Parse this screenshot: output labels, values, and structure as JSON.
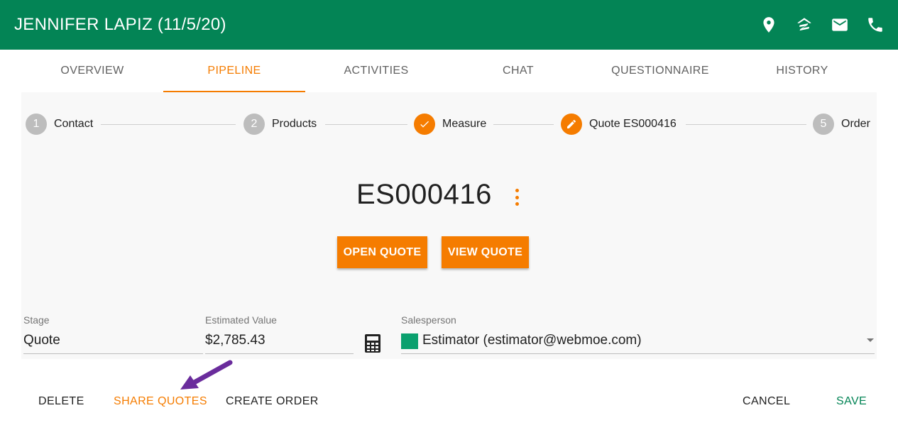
{
  "header": {
    "title": "JENNIFER LAPIZ (11/5/20)",
    "icons": [
      "location-pin-icon",
      "zillow-icon",
      "mail-icon",
      "phone-icon"
    ],
    "color": "#038455"
  },
  "tabs": [
    {
      "label": "OVERVIEW",
      "active": false
    },
    {
      "label": "PIPELINE",
      "active": true
    },
    {
      "label": "ACTIVITIES",
      "active": false
    },
    {
      "label": "CHAT",
      "active": false
    },
    {
      "label": "QUESTIONNAIRE",
      "active": false
    },
    {
      "label": "HISTORY",
      "active": false
    }
  ],
  "stepper": [
    {
      "marker": "1",
      "label": "Contact",
      "state": "pending"
    },
    {
      "marker": "2",
      "label": "Products",
      "state": "pending"
    },
    {
      "marker": "check-icon",
      "label": "Measure",
      "state": "done"
    },
    {
      "marker": "pencil-icon",
      "label": "Quote ES000416",
      "state": "current"
    },
    {
      "marker": "5",
      "label": "Order",
      "state": "pending"
    }
  ],
  "quote": {
    "number": "ES000416",
    "open_label": "OPEN QUOTE",
    "view_label": "VIEW QUOTE"
  },
  "fields": {
    "stage": {
      "label": "Stage",
      "value": "Quote"
    },
    "estimated_value": {
      "label": "Estimated Value",
      "value": "$2,785.43"
    },
    "salesperson": {
      "label": "Salesperson",
      "value": "Estimator (estimator@webmoe.com)",
      "swatch_color": "#0aa06e"
    }
  },
  "actions": {
    "delete": "DELETE",
    "share_quotes": "SHARE QUOTES",
    "create_order": "CREATE ORDER",
    "cancel": "CANCEL",
    "save": "SAVE"
  },
  "colors": {
    "accent": "#f57c00",
    "brand": "#038455",
    "annotation_arrow": "#6a2c9c"
  }
}
